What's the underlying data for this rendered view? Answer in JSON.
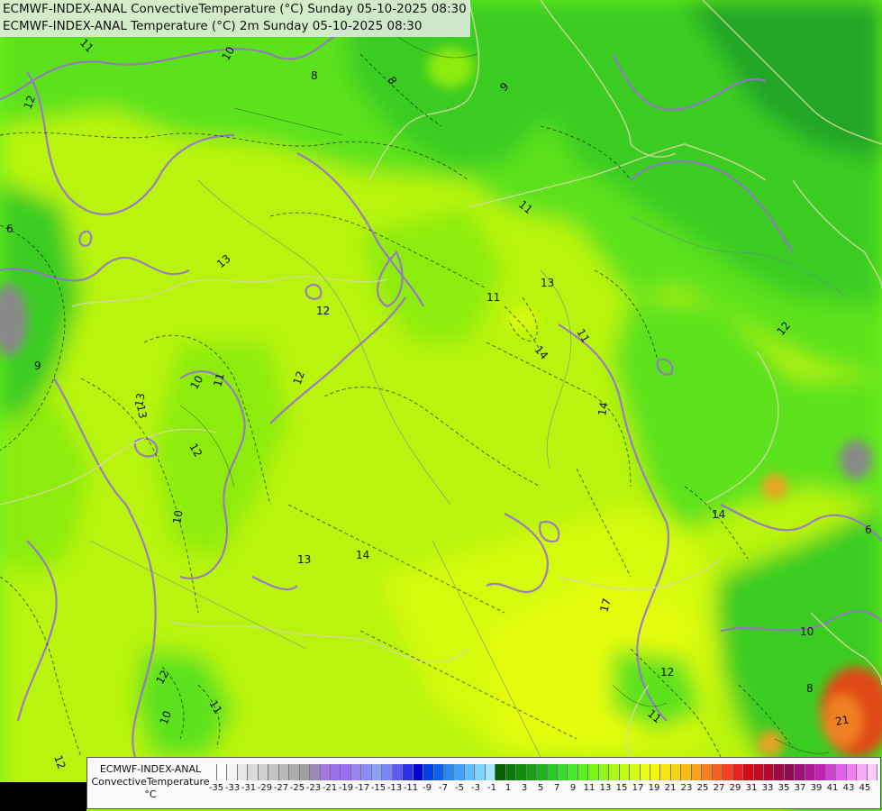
{
  "titles": [
    "ECMWF-INDEX-ANAL ConvectiveTemperature (°C) Sunday 05-10-2025 08:30",
    "ECMWF-INDEX-ANAL Temperature (°C) 2m Sunday 05-10-2025 08:30"
  ],
  "legend": {
    "label_lines": [
      "ECMWF-INDEX-ANAL",
      "ConvectiveTemperature",
      "°C"
    ],
    "tick_labels": [
      "-35",
      "-33",
      "-31",
      "-29",
      "-27",
      "-25",
      "-23",
      "-21",
      "-19",
      "-17",
      "-15",
      "-13",
      "-11",
      "-9",
      "-7",
      "-5",
      "-3",
      "-1",
      "1",
      "3",
      "5",
      "7",
      "9",
      "11",
      "13",
      "15",
      "17",
      "19",
      "21",
      "23",
      "25",
      "27",
      "29",
      "31",
      "33",
      "35",
      "37",
      "39",
      "41",
      "43",
      "45"
    ],
    "colors": [
      "#ffffff",
      "#f3f3f3",
      "#e6e6e6",
      "#dadada",
      "#cfcfcf",
      "#c3c3c3",
      "#b8b8b8",
      "#adadad",
      "#a0a0a0",
      "#9a89b6",
      "#a178e0",
      "#9a6cee",
      "#9a6cf8",
      "#9c84f0",
      "#8c8cf8",
      "#8aa0f5",
      "#7a86f3",
      "#5a5af5",
      "#3030e8",
      "#0000d8",
      "#0040e8",
      "#1060f0",
      "#2888f4",
      "#40a0f8",
      "#60bcfa",
      "#80d4fc",
      "#a0e8fe",
      "#066000",
      "#0a7a06",
      "#108c0e",
      "#18a018",
      "#22b420",
      "#2cc828",
      "#38dc2c",
      "#4ae830",
      "#5ef01e",
      "#78f418",
      "#90f818",
      "#a8fa18",
      "#c0fc18",
      "#d6fe14",
      "#e8ff10",
      "#f4f808",
      "#f8e80a",
      "#f8d40c",
      "#f8bc14",
      "#f8a020",
      "#f88020",
      "#f86020",
      "#f84020",
      "#e82020",
      "#d80818",
      "#c80820",
      "#b40830",
      "#a00840",
      "#900850",
      "#a01078",
      "#b01898",
      "#c020b8",
      "#d040d0",
      "#e060e8",
      "#f080f4",
      "#f8a8f8",
      "#ffc8ff"
    ],
    "unit": "°C"
  },
  "map": {
    "contour_labels": [
      {
        "text": "11"
      },
      {
        "text": "10"
      },
      {
        "text": "12"
      },
      {
        "text": "8"
      },
      {
        "text": "6"
      },
      {
        "text": "13"
      },
      {
        "text": "12"
      },
      {
        "text": "11"
      },
      {
        "text": "13"
      },
      {
        "text": "12"
      },
      {
        "text": "11"
      },
      {
        "text": "10"
      },
      {
        "text": "12"
      },
      {
        "text": "13"
      },
      {
        "text": "14"
      },
      {
        "text": "13"
      },
      {
        "text": "14"
      },
      {
        "text": "12"
      },
      {
        "text": "11"
      },
      {
        "text": "10"
      },
      {
        "text": "11"
      },
      {
        "text": "12"
      },
      {
        "text": "14"
      },
      {
        "text": "17"
      },
      {
        "text": "10"
      },
      {
        "text": "8"
      },
      {
        "text": "12"
      },
      {
        "text": "11"
      },
      {
        "text": "9"
      },
      {
        "text": "6"
      },
      {
        "text": "10"
      },
      {
        "text": "14"
      },
      {
        "text": "21"
      },
      {
        "text": "12"
      },
      {
        "text": "8"
      },
      {
        "text": "13"
      },
      {
        "text": "9"
      },
      {
        "text": "11"
      }
    ],
    "colors": {
      "base": "#b8f40e",
      "warm": "#d4fa0e",
      "warmest": "#e6fc0a",
      "mid": "#8cec10",
      "cool": "#5ce21c",
      "cooler": "#3acc22",
      "coolest": "#22a628",
      "isotherm": "#9a70d0",
      "border": "#d8d8a0",
      "contour": "#1a2a10",
      "orange": "#f08020",
      "red": "#e04a18",
      "gray": "#888888"
    }
  }
}
